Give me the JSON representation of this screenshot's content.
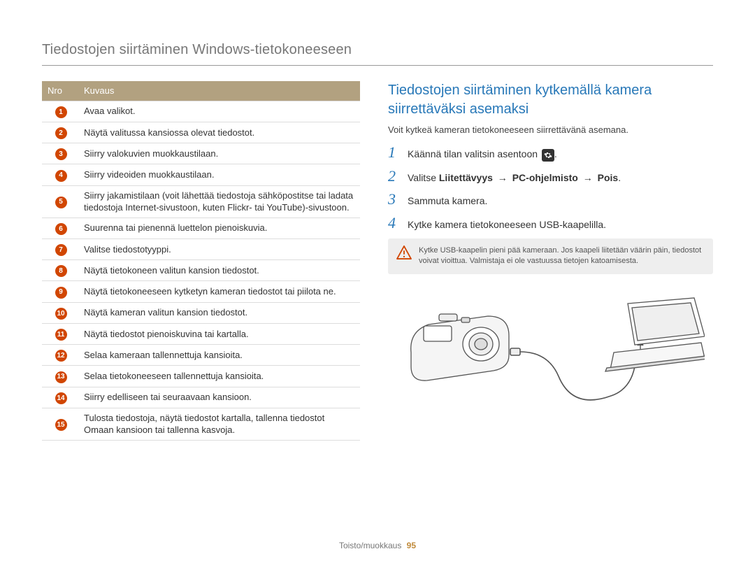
{
  "header": "Tiedostojen siirtäminen Windows-tietokoneeseen",
  "table": {
    "cols": {
      "nro": "Nro",
      "kuvaus": "Kuvaus"
    },
    "rows": [
      {
        "n": "1",
        "d": "Avaa valikot."
      },
      {
        "n": "2",
        "d": "Näytä valitussa kansiossa olevat tiedostot."
      },
      {
        "n": "3",
        "d": "Siirry valokuvien muokkaustilaan."
      },
      {
        "n": "4",
        "d": "Siirry videoiden muokkaustilaan."
      },
      {
        "n": "5",
        "d": "Siirry jakamistilaan (voit lähettää tiedostoja sähköpostitse tai ladata tiedostoja Internet-sivustoon, kuten Flickr- tai YouTube)-sivustoon."
      },
      {
        "n": "6",
        "d": "Suurenna tai pienennä luettelon pienoiskuvia."
      },
      {
        "n": "7",
        "d": "Valitse tiedostotyyppi."
      },
      {
        "n": "8",
        "d": "Näytä tietokoneen valitun kansion tiedostot."
      },
      {
        "n": "9",
        "d": "Näytä tietokoneeseen kytketyn kameran tiedostot tai piilota ne."
      },
      {
        "n": "10",
        "d": "Näytä kameran valitun kansion tiedostot."
      },
      {
        "n": "11",
        "d": "Näytä tiedostot pienoiskuvina tai kartalla."
      },
      {
        "n": "12",
        "d": "Selaa kameraan tallennettuja kansioita."
      },
      {
        "n": "13",
        "d": "Selaa tietokoneeseen tallennettuja kansioita."
      },
      {
        "n": "14",
        "d": "Siirry edelliseen tai seuraavaan kansioon."
      },
      {
        "n": "15",
        "d": "Tulosta tiedostoja, näytä tiedostot kartalla, tallenna tiedostot Omaan kansioon tai tallenna kasvoja."
      }
    ]
  },
  "section": {
    "title": "Tiedostojen siirtäminen kytkemällä kamera siirrettäväksi asemaksi",
    "intro": "Voit kytkeä kameran tietokoneeseen siirrettävänä asemana.",
    "steps": [
      {
        "n": "1",
        "pre": "Käännä tilan valitsin asentoon ",
        "icon": "gear",
        "post": "."
      },
      {
        "n": "2",
        "pre": "Valitse ",
        "b1": "Liitettävyys",
        "a1": " → ",
        "b2": "PC-ohjelmisto",
        "a2": " → ",
        "b3": "Pois",
        "post": "."
      },
      {
        "n": "3",
        "pre": "Sammuta kamera."
      },
      {
        "n": "4",
        "pre": "Kytke kamera tietokoneeseen USB-kaapelilla."
      }
    ],
    "warn": "Kytke USB-kaapelin pieni pää kameraan. Jos kaapeli liitetään väärin päin, tiedostot voivat vioittua. Valmistaja ei ole vastuussa tietojen katoamisesta."
  },
  "footer": {
    "label": "Toisto/muokkaus",
    "page": "95"
  }
}
